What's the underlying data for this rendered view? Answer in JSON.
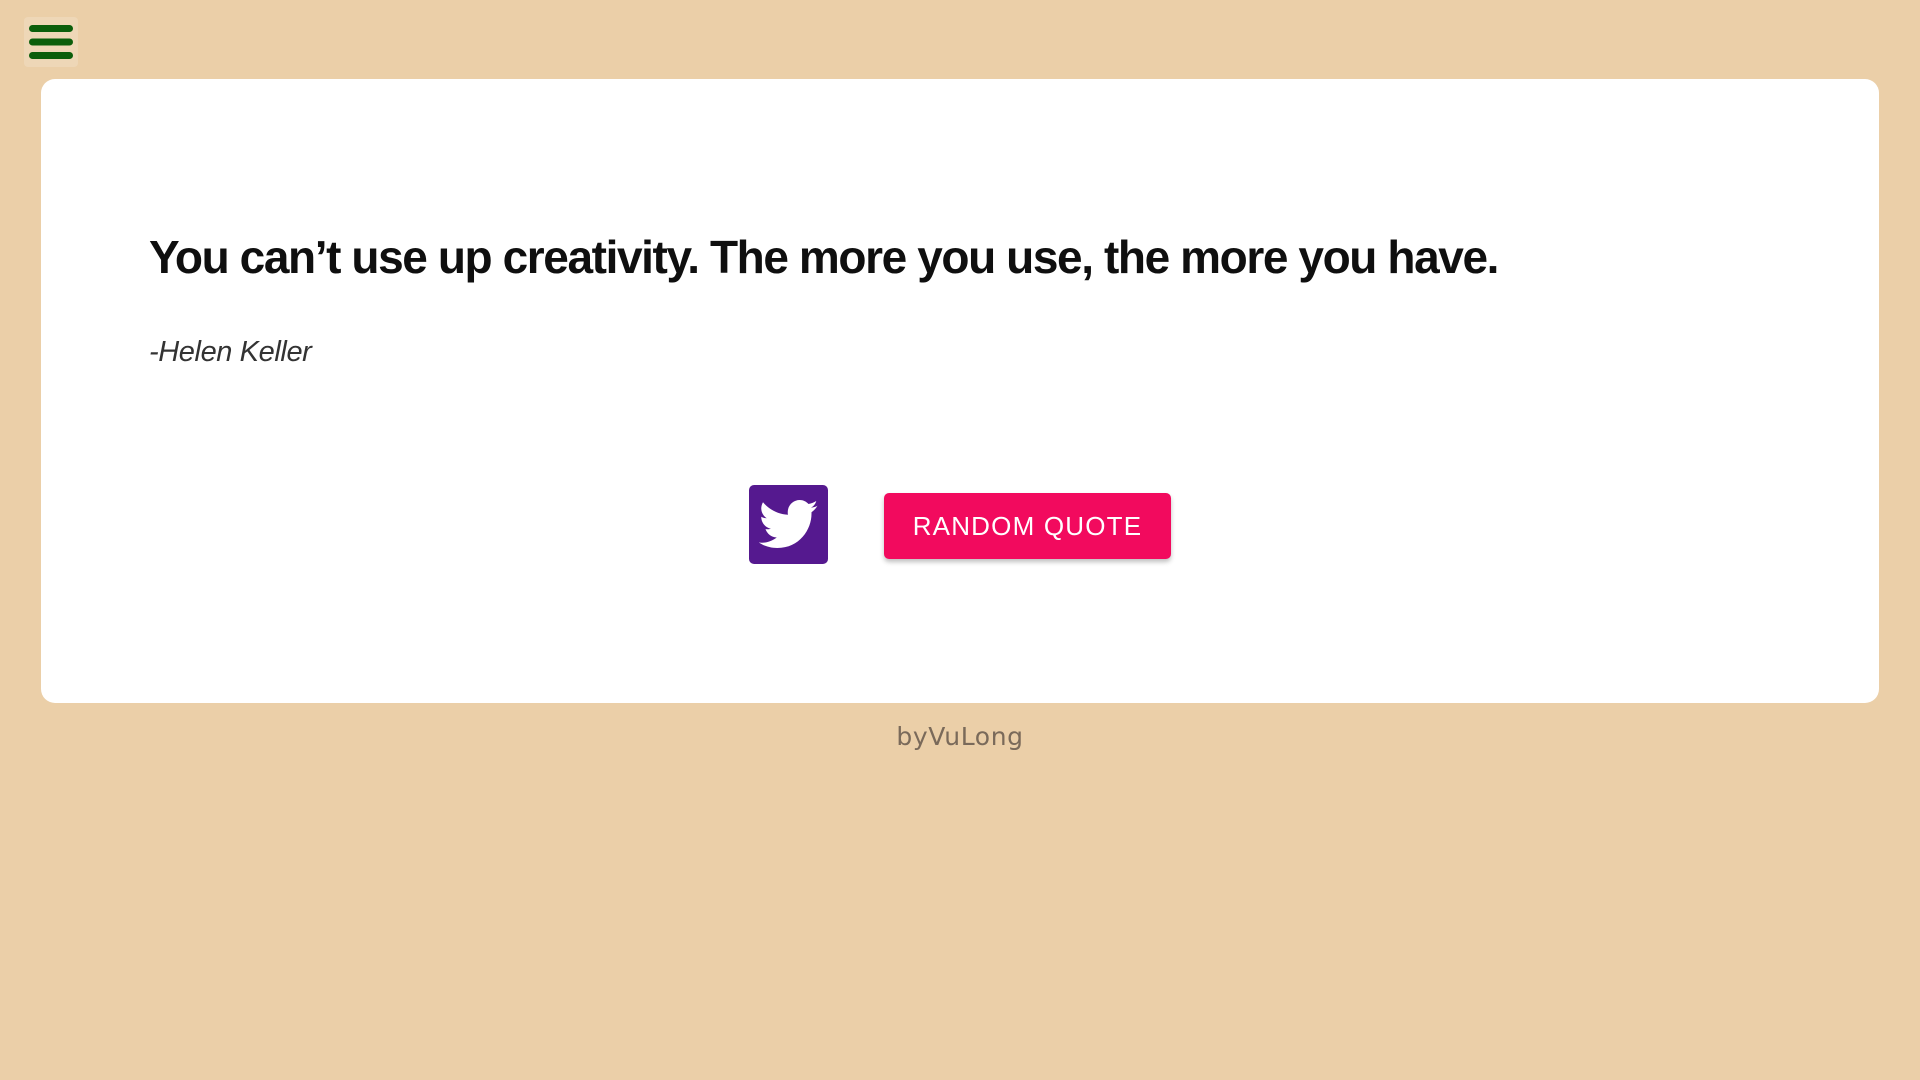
{
  "menu": {
    "icon": "hamburger-menu-icon",
    "color": "#0B5E0B"
  },
  "quote": {
    "text": "You can’t use up creativity. The more you use, the more you have.",
    "author": "-Helen Keller"
  },
  "actions": {
    "tweet_icon": "twitter-icon",
    "tweet_color": "#55198F",
    "random_label": "RANDOM QUOTE",
    "random_color": "#F20A5E"
  },
  "footer": {
    "credit": "byVuLong"
  },
  "theme": {
    "background": "#EBCFA8",
    "card": "#FFFFFF"
  }
}
